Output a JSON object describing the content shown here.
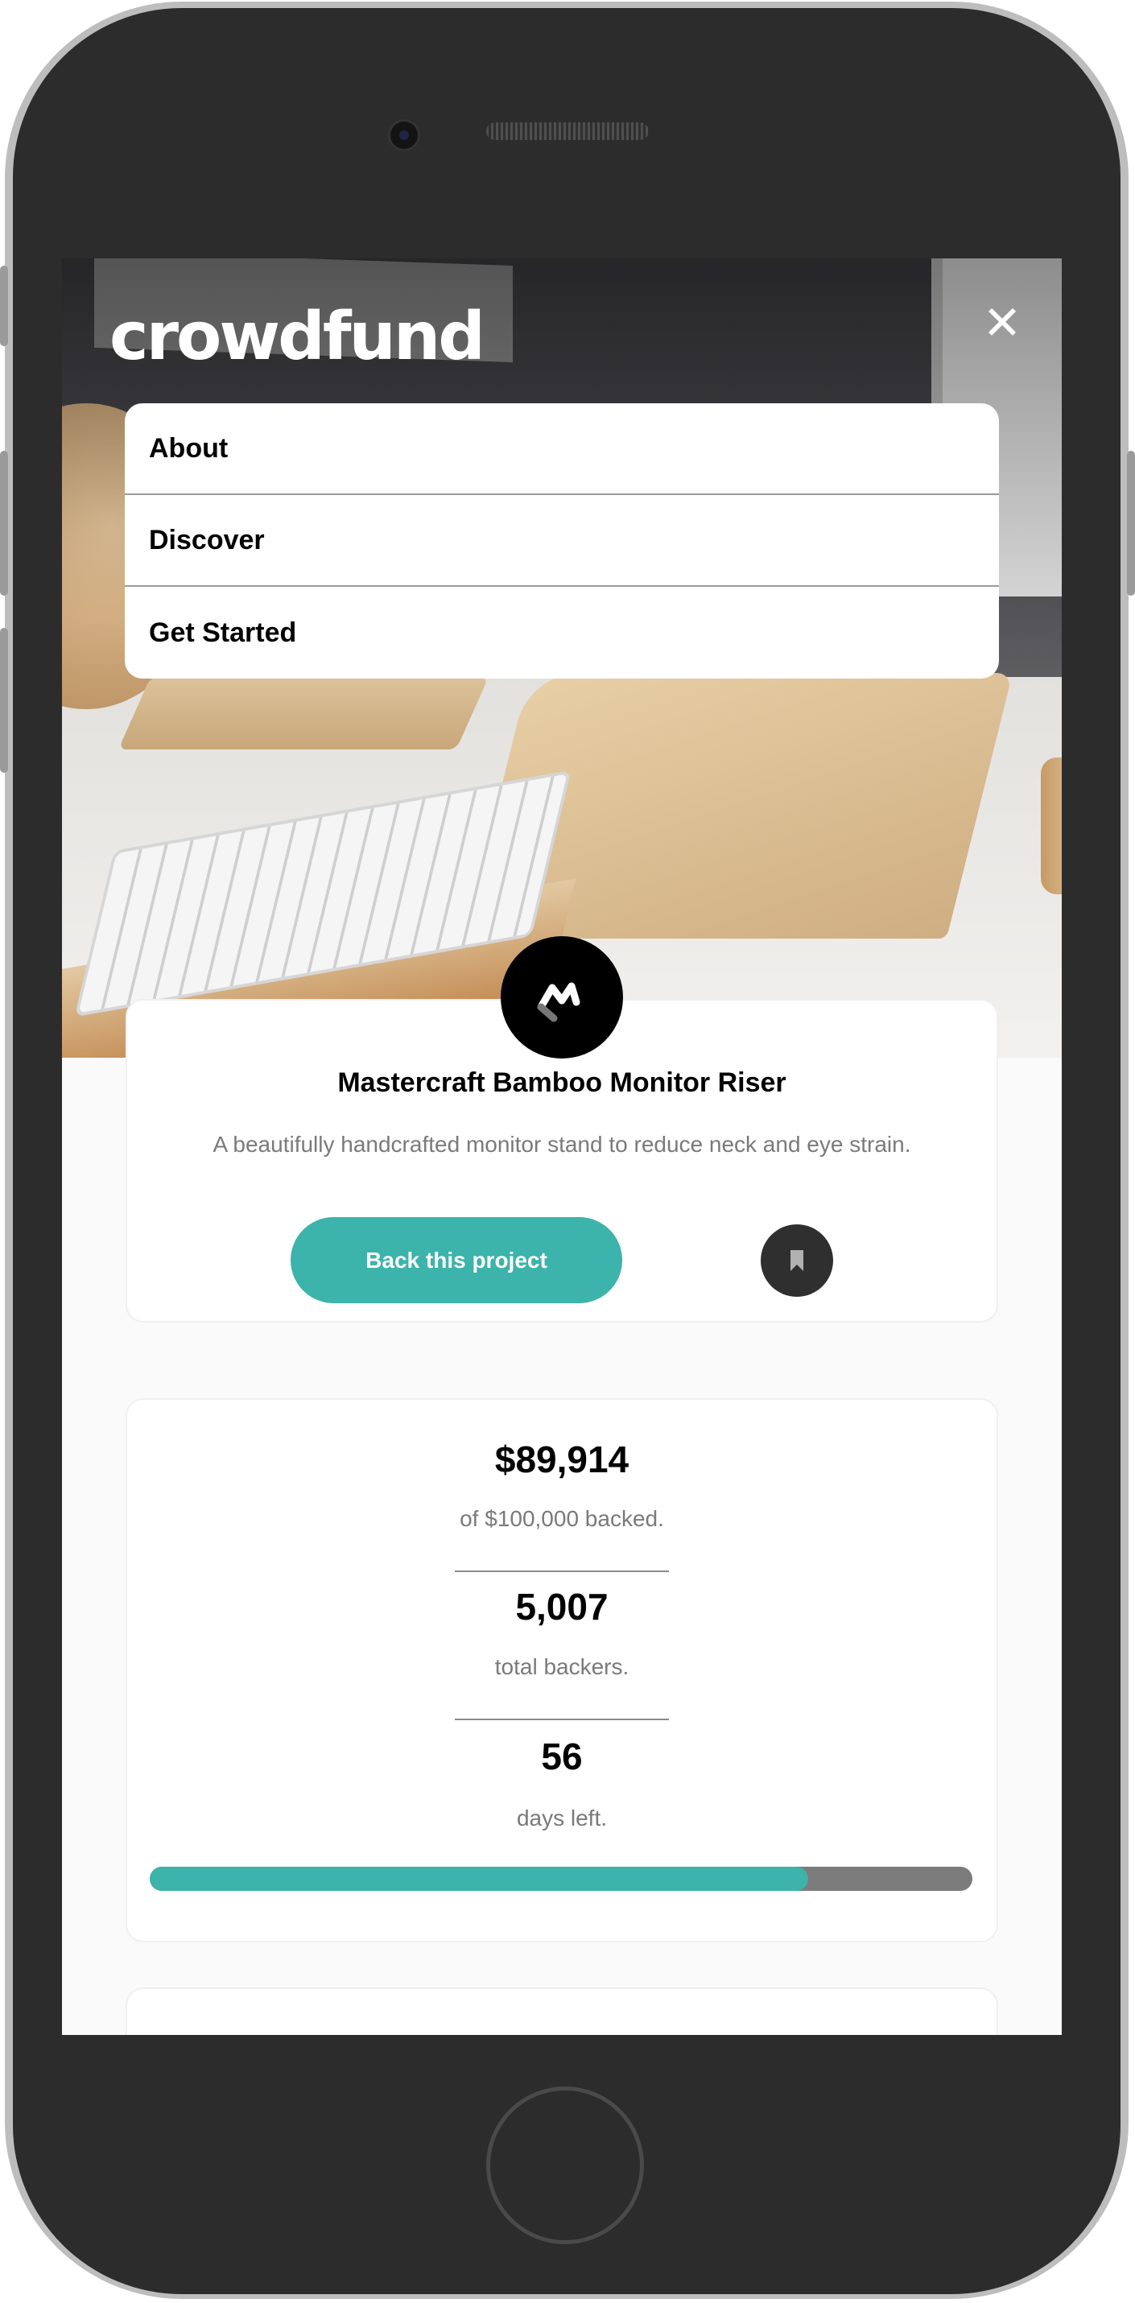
{
  "app": {
    "logo": "crowdfund",
    "close_icon": "close-icon",
    "accent_color": "#3cb3ab"
  },
  "nav": {
    "items": [
      {
        "label": "About"
      },
      {
        "label": "Discover"
      },
      {
        "label": "Get Started"
      }
    ]
  },
  "project": {
    "brand_icon": "mastercraft-logo-icon",
    "title": "Mastercraft Bamboo Monitor Riser",
    "description": "A beautifully handcrafted monitor stand to reduce neck and eye strain.",
    "back_label": "Back this project",
    "bookmark_icon": "bookmark-icon"
  },
  "stats": {
    "backed_amount": "$89,914",
    "backed_label": "of $100,000 backed.",
    "backers_count": "5,007",
    "backers_label": "total backers.",
    "days_left": "56",
    "days_label": "days left.",
    "progress_fraction": 0.8
  }
}
